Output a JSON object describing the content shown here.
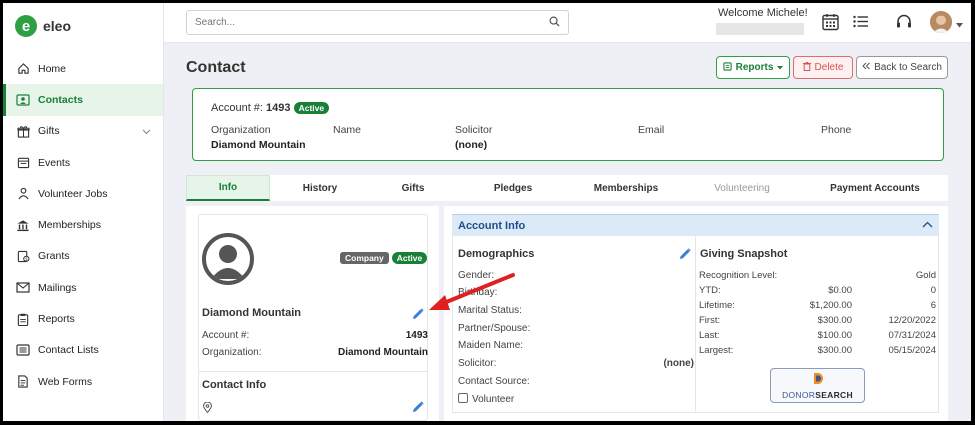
{
  "app": {
    "logo_letter": "e",
    "logo_text": "eleo"
  },
  "sidebar": {
    "items": [
      {
        "label": "Home",
        "icon": "home-icon"
      },
      {
        "label": "Contacts",
        "icon": "contact-card-icon",
        "active": true
      },
      {
        "label": "Gifts",
        "icon": "gift-icon",
        "has_submenu": true
      },
      {
        "label": "Events",
        "icon": "calendar-icon"
      },
      {
        "label": "Volunteer Jobs",
        "icon": "person-icon"
      },
      {
        "label": "Memberships",
        "icon": "building-icon"
      },
      {
        "label": "Grants",
        "icon": "grant-icon"
      },
      {
        "label": "Mailings",
        "icon": "mail-icon"
      },
      {
        "label": "Reports",
        "icon": "clipboard-icon"
      },
      {
        "label": "Contact Lists",
        "icon": "list-icon"
      },
      {
        "label": "Web Forms",
        "icon": "document-icon"
      }
    ]
  },
  "topbar": {
    "search_placeholder": "Search...",
    "welcome": "Welcome Michele!"
  },
  "page": {
    "title": "Contact",
    "reports_label": "Reports",
    "delete_label": "Delete",
    "back_label": "Back to Search"
  },
  "summary": {
    "account_label": "Account #:",
    "account_number": "1493",
    "status": "Active",
    "organization_label": "Organization",
    "organization_value": "Diamond Mountain",
    "name_label": "Name",
    "solicitor_label": "Solicitor",
    "solicitor_value": "(none)",
    "email_label": "Email",
    "phone_label": "Phone"
  },
  "tabs": [
    {
      "label": "Info",
      "active": true
    },
    {
      "label": "History"
    },
    {
      "label": "Gifts"
    },
    {
      "label": "Pledges"
    },
    {
      "label": "Memberships"
    },
    {
      "label": "Volunteering",
      "disabled": true
    },
    {
      "label": "Payment Accounts"
    }
  ],
  "profile": {
    "type_badge": "Company",
    "status_badge": "Active",
    "name": "Diamond Mountain",
    "account_label": "Account #:",
    "account_value": "1493",
    "organization_label": "Organization:",
    "organization_value": "Diamond Mountain",
    "contact_info_title": "Contact Info"
  },
  "account_info": {
    "title": "Account Info",
    "demographics": {
      "title": "Demographics",
      "gender_label": "Gender:",
      "birthday_label": "Birthday:",
      "marital_label": "Marital Status:",
      "partner_label": "Partner/Spouse:",
      "maiden_label": "Maiden Name:",
      "solicitor_label": "Solicitor:",
      "solicitor_value": "(none)",
      "source_label": "Contact Source:",
      "volunteer_label": "Volunteer"
    },
    "giving": {
      "title": "Giving Snapshot",
      "recognition_label": "Recognition Level:",
      "recognition_value": "Gold",
      "rows": [
        {
          "label": "YTD:",
          "amount": "$0.00",
          "extra": "0"
        },
        {
          "label": "Lifetime:",
          "amount": "$1,200.00",
          "extra": "6"
        },
        {
          "label": "First:",
          "amount": "$300.00",
          "extra": "12/20/2022"
        },
        {
          "label": "Last:",
          "amount": "$100.00",
          "extra": "07/31/2024"
        },
        {
          "label": "Largest:",
          "amount": "$300.00",
          "extra": "05/15/2024"
        }
      ],
      "donor_search_a": "DONOR",
      "donor_search_b": "SEARCH"
    }
  },
  "colors": {
    "brand": "#2ea043",
    "brand_dark": "#1a7f37",
    "danger": "#d9534f",
    "header_blue": "#dce9f7",
    "annotation_arrow": "#e02020"
  }
}
